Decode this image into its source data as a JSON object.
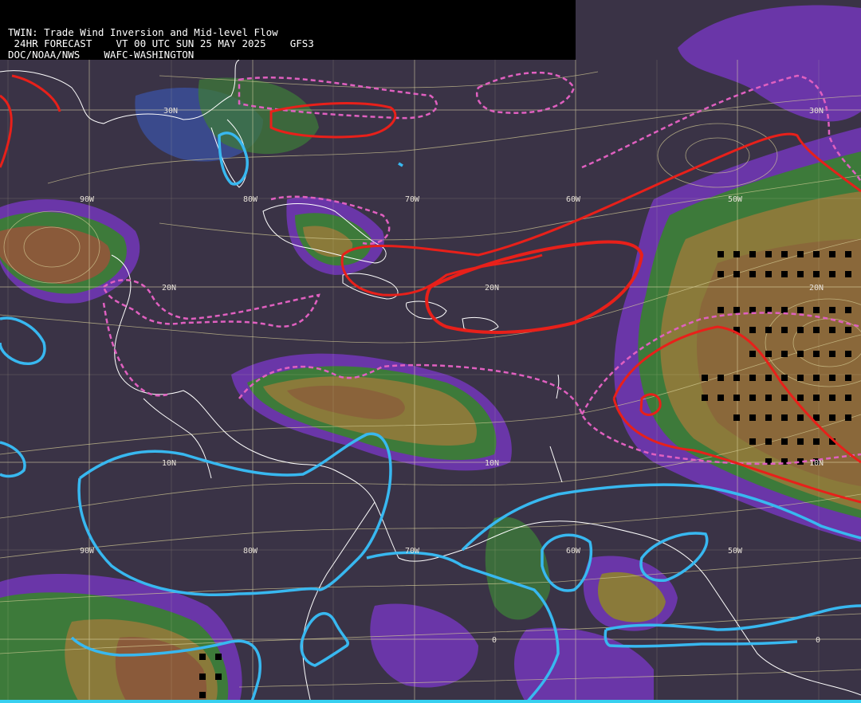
{
  "header": {
    "line1": "TWIN: Trade Wind Inversion and Mid-level Flow",
    "line2": " 24HR FORECAST    VT 00 UTC SUN 25 MAY 2025    GFS3",
    "line3": "DOC/NOAA/NWS    WAFC-WASHINGTON"
  },
  "labels": {
    "lat30w": "30N",
    "lat30e": "30N",
    "lat20w": "20N",
    "lat20c": "20N",
    "lat20e": "20N",
    "lat10w": "10N",
    "lat10c": "10N",
    "lat10e": "10N",
    "lat0c": "0",
    "lat0e": "0",
    "lon90": "90W",
    "lon80": "80W",
    "lon70": "70W",
    "lon60": "60W",
    "lon50": "50W",
    "lon90b": "90W",
    "lon80b": "80W",
    "lon70b": "70W",
    "lon60b": "60W",
    "lon50b": "50W"
  },
  "colors": {
    "background": "#3a3346",
    "purple": "#6a36a8",
    "blue": "#3a4a8c",
    "green": "#3d7a3a",
    "olive": "#8a7a3a",
    "brown": "#8a5a3a",
    "cyan_contour": "#38b8f0",
    "red_contour": "#e8201a",
    "pink_dashed": "#e060c0",
    "streamline": "#d8d098",
    "coastline": "#ffffff"
  }
}
